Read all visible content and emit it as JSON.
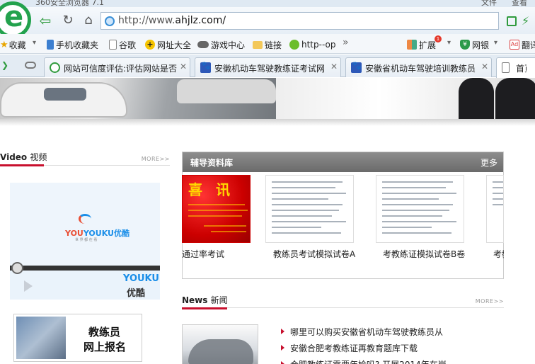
{
  "window": {
    "title": "360安全浏览器 7.1",
    "menu_items": [
      "文件",
      "查看"
    ]
  },
  "address_bar": {
    "url_prefix": "http://www.",
    "url_domain": "ahjlz.com/"
  },
  "bookmarks": {
    "items": [
      {
        "label": "收藏",
        "icon": "star-icon"
      },
      {
        "label": "手机收藏夹",
        "icon": "phone-icon"
      },
      {
        "label": "谷歌",
        "icon": "page-icon"
      },
      {
        "label": "网址大全",
        "icon": "plus-circle-icon"
      },
      {
        "label": "游戏中心",
        "icon": "gamepad-icon"
      },
      {
        "label": "链接",
        "icon": "folder-icon"
      },
      {
        "label": "http--op",
        "icon": "chat-bubble-icon"
      }
    ],
    "right_items": [
      {
        "label": "扩展",
        "icon": "grid-icon",
        "badge": "1"
      },
      {
        "label": "网银",
        "icon": "shield-icon"
      },
      {
        "label": "翻译",
        "icon": "ad-icon"
      }
    ]
  },
  "tabs": [
    {
      "label": "网站可信度评估:评估网站是否",
      "icon": "green-circle-icon",
      "active": false
    },
    {
      "label": "安徽机动车驾驶教练证考试网",
      "icon": "paw-icon",
      "active": false
    },
    {
      "label": "安徽省机动车驾驶培训教练员",
      "icon": "paw-icon",
      "active": false
    },
    {
      "label": "首页-",
      "icon": "document-icon",
      "active": true
    }
  ],
  "page": {
    "video_section": {
      "title_en": "Video",
      "title_cn": "视频",
      "more": "MORE>>",
      "player_brand": "YOUKU",
      "player_brand_cn": "优酷",
      "player_slogan": "世 界 都 在 看"
    },
    "signup": {
      "line1": "教练员",
      "line2": "网上报名"
    },
    "materials": {
      "title": "辅导资料库",
      "more": "更多",
      "thumb_banner_text": "喜 讯",
      "items": [
        {
          "caption": "通过率考试"
        },
        {
          "caption": "教练员考试模拟试卷A"
        },
        {
          "caption": "考教练证模拟试卷B卷"
        },
        {
          "caption": "考教"
        }
      ]
    },
    "news_section": {
      "title_en": "News",
      "title_cn": "新闻",
      "more": "MORE>>",
      "items": [
        "哪里可以购买安徽省机动车驾驶教练员从",
        "安徽合肥考教练证再教育题库下载",
        "合肥教练证需要年检吗? 开展2014年在岗"
      ]
    }
  }
}
